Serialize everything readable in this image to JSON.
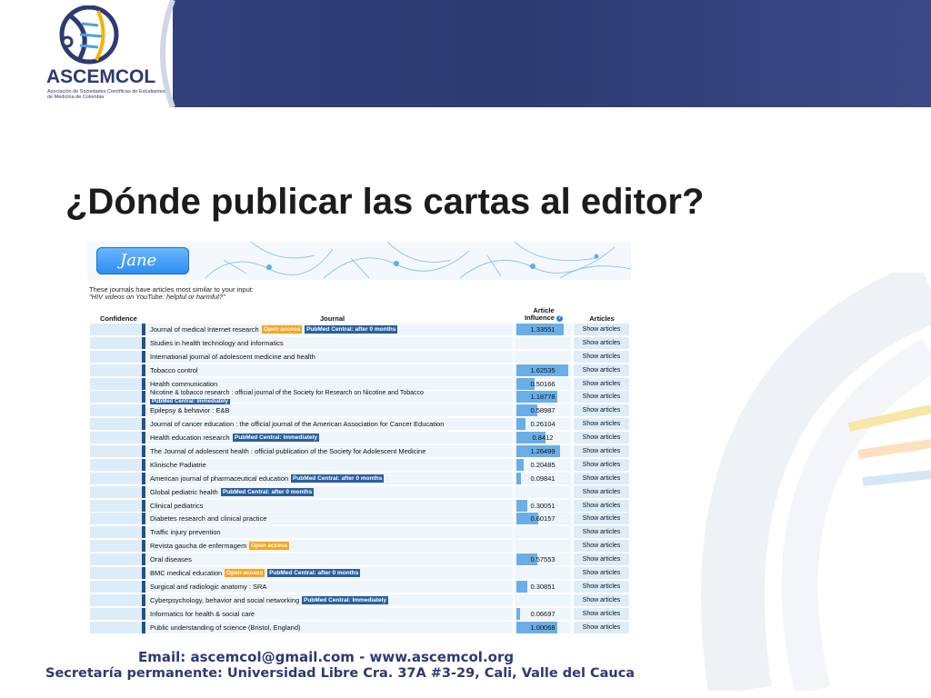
{
  "header": {
    "org_name": "ASCEMCOL",
    "org_tagline": "Asociación de Sociedades Científicas de Estudiantes de Medicina de Colombia",
    "colors": {
      "navy": "#2d3a72",
      "accent_blue": "#2d8cf0"
    }
  },
  "slide": {
    "title": "¿Dónde publicar las cartas al editor?"
  },
  "jane": {
    "brand_label": "Jane",
    "intro_line1": "These journals have articles most similar to your input:",
    "intro_line2": "\"HIV videos on YouTube: helpful or harmful?\"",
    "columns": {
      "confidence": "Confidence",
      "journal": "Journal",
      "ai_line1": "Article",
      "ai_line2": "Influence",
      "articles": "Articles",
      "info_icon": "?"
    },
    "show_label": "Show articles",
    "badge_oa": "Open access",
    "rows": [
      {
        "name": "Journal of medical Internet research",
        "oa": true,
        "pmc": "PubMed Central: after 0 months",
        "ai": "1.33551",
        "ai_frac": 0.89
      },
      {
        "name": "Studies in health technology and informatics",
        "oa": false,
        "pmc": "",
        "ai": "",
        "ai_frac": 0
      },
      {
        "name": "International journal of adolescent medicine and health",
        "oa": false,
        "pmc": "",
        "ai": "",
        "ai_frac": 0
      },
      {
        "name": "Tobacco control",
        "oa": false,
        "pmc": "",
        "ai": "1.62535",
        "ai_frac": 0.98
      },
      {
        "name": "Health communication",
        "oa": false,
        "pmc": "",
        "ai": "0.50166",
        "ai_frac": 0.35
      },
      {
        "name": "Nicotine & tobacco research : official journal of the Society for Research on Nicotine and Tobacco",
        "oa": false,
        "pmc": "PubMed Central: Immediately",
        "ai": "1.18778",
        "ai_frac": 0.78,
        "two_line": true
      },
      {
        "name": "Epilepsy & behavior : E&B",
        "oa": false,
        "pmc": "",
        "ai": "0.58987",
        "ai_frac": 0.4
      },
      {
        "name": "Journal of cancer education : the official journal of the American Association for Cancer Education",
        "oa": false,
        "pmc": "",
        "ai": "0.26104",
        "ai_frac": 0.18
      },
      {
        "name": "Health education research",
        "oa": false,
        "pmc": "PubMed Central: Immediately",
        "ai": "0.8412",
        "ai_frac": 0.56
      },
      {
        "name": "The Journal of adolescent health : official publication of the Society for Adolescent Medicine",
        "oa": false,
        "pmc": "",
        "ai": "1.26499",
        "ai_frac": 0.83
      },
      {
        "name": "Klinische Padiatrie",
        "oa": false,
        "pmc": "",
        "ai": "0.20485",
        "ai_frac": 0.14
      },
      {
        "name": "American journal of pharmaceutical education",
        "oa": false,
        "pmc": "PubMed Central: after 0 months",
        "ai": "0.09841",
        "ai_frac": 0.08
      },
      {
        "name": "Global pediatric health",
        "oa": false,
        "pmc": "PubMed Central: after 0 months",
        "ai": "",
        "ai_frac": 0
      },
      {
        "name": "Clinical pediatrics",
        "oa": false,
        "pmc": "",
        "ai": "0.30051",
        "ai_frac": 0.2
      },
      {
        "name": "Diabetes research and clinical practice",
        "oa": false,
        "pmc": "",
        "ai": "0.60157",
        "ai_frac": 0.42
      },
      {
        "name": "Traffic injury prevention",
        "oa": false,
        "pmc": "",
        "ai": "",
        "ai_frac": 0
      },
      {
        "name": "Revista gaucha de enfermagem",
        "oa": true,
        "pmc": "",
        "ai": "",
        "ai_frac": 0
      },
      {
        "name": "Oral diseases",
        "oa": false,
        "pmc": "",
        "ai": "0.57553",
        "ai_frac": 0.4
      },
      {
        "name": "BMC medical education",
        "oa": true,
        "pmc": "PubMed Central: after 0 months",
        "ai": "",
        "ai_frac": 0
      },
      {
        "name": "Surgical and radiologic anatomy : SRA",
        "oa": false,
        "pmc": "",
        "ai": "0.30851",
        "ai_frac": 0.2
      },
      {
        "name": "Cyberpsychology, behavior and social networking",
        "oa": false,
        "pmc": "PubMed Central: Immediately",
        "ai": "",
        "ai_frac": 0
      },
      {
        "name": "Informatics for health & social care",
        "oa": false,
        "pmc": "",
        "ai": "0.06697",
        "ai_frac": 0.07
      },
      {
        "name": "Public understanding of science (Bristol, England)",
        "oa": false,
        "pmc": "",
        "ai": "1.00068",
        "ai_frac": 0.78
      }
    ]
  },
  "footer": {
    "email_line": "Email: ascemcol@gmail.com  - www.ascemcol.org",
    "address_line": "Secretaría permanente: Universidad Libre Cra. 37A #3-29, Cali, Valle del Cauca"
  }
}
